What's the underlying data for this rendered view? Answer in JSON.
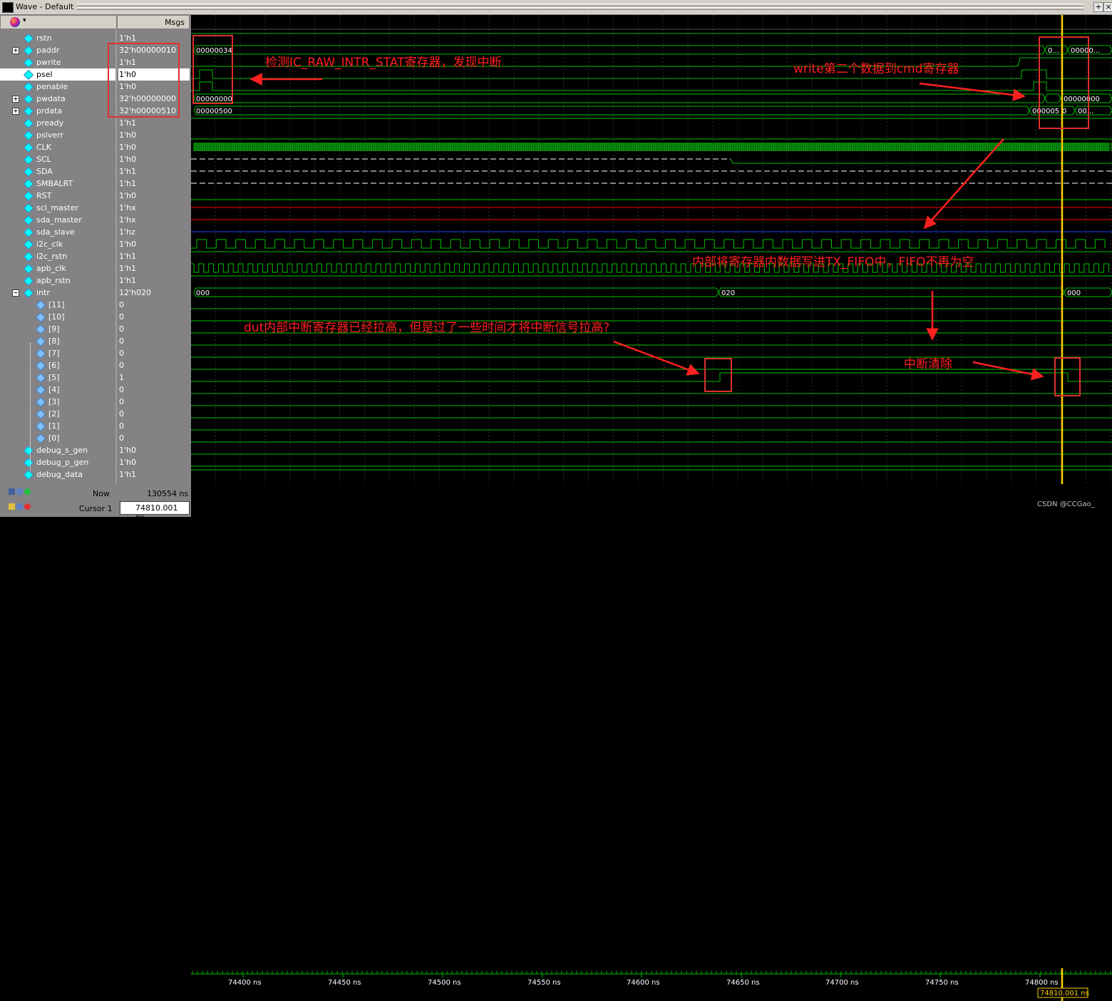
{
  "window": {
    "title": "Wave - Default",
    "buttons": [
      "+",
      "×"
    ]
  },
  "header": {
    "msgs_label": "Msgs"
  },
  "signals": [
    {
      "name": "rstn",
      "value": "1'h1",
      "expandable": false,
      "indent": 0
    },
    {
      "name": "paddr",
      "value": "32'h00000010",
      "expandable": true,
      "indent": 0
    },
    {
      "name": "pwrite",
      "value": "1'h1",
      "expandable": false,
      "indent": 0
    },
    {
      "name": "psel",
      "value": "1'h0",
      "expandable": false,
      "indent": 0,
      "selected": true
    },
    {
      "name": "penable",
      "value": "1'h0",
      "expandable": false,
      "indent": 0
    },
    {
      "name": "pwdata",
      "value": "32'h00000000",
      "expandable": true,
      "indent": 0
    },
    {
      "name": "prdata",
      "value": "32'h00000510",
      "expandable": true,
      "indent": 0
    },
    {
      "name": "pready",
      "value": "1'h1",
      "expandable": false,
      "indent": 0
    },
    {
      "name": "pslverr",
      "value": "1'h0",
      "expandable": false,
      "indent": 0
    },
    {
      "name": "CLK",
      "value": "1'h0",
      "expandable": false,
      "indent": 0
    },
    {
      "name": "SCL",
      "value": "1'h0",
      "expandable": false,
      "indent": 0
    },
    {
      "name": "SDA",
      "value": "1'h1",
      "expandable": false,
      "indent": 0
    },
    {
      "name": "SMBALRT",
      "value": "1'h1",
      "expandable": false,
      "indent": 0
    },
    {
      "name": "RST",
      "value": "1'h0",
      "expandable": false,
      "indent": 0
    },
    {
      "name": "scl_master",
      "value": "1'hx",
      "expandable": false,
      "indent": 0
    },
    {
      "name": "sda_master",
      "value": "1'hx",
      "expandable": false,
      "indent": 0
    },
    {
      "name": "sda_slave",
      "value": "1'hz",
      "expandable": false,
      "indent": 0
    },
    {
      "name": "i2c_clk",
      "value": "1'h0",
      "expandable": false,
      "indent": 0
    },
    {
      "name": "i2c_rstn",
      "value": "1'h1",
      "expandable": false,
      "indent": 0
    },
    {
      "name": "apb_clk",
      "value": "1'h1",
      "expandable": false,
      "indent": 0
    },
    {
      "name": "apb_rstn",
      "value": "1'h1",
      "expandable": false,
      "indent": 0
    },
    {
      "name": "intr",
      "value": "12'h020",
      "expandable": true,
      "expanded": true,
      "indent": 0
    },
    {
      "name": "[11]",
      "value": "0",
      "expandable": false,
      "indent": 1
    },
    {
      "name": "[10]",
      "value": "0",
      "expandable": false,
      "indent": 1
    },
    {
      "name": "[9]",
      "value": "0",
      "expandable": false,
      "indent": 1
    },
    {
      "name": "[8]",
      "value": "0",
      "expandable": false,
      "indent": 1
    },
    {
      "name": "[7]",
      "value": "0",
      "expandable": false,
      "indent": 1
    },
    {
      "name": "[6]",
      "value": "0",
      "expandable": false,
      "indent": 1
    },
    {
      "name": "[5]",
      "value": "1",
      "expandable": false,
      "indent": 1
    },
    {
      "name": "[4]",
      "value": "0",
      "expandable": false,
      "indent": 1
    },
    {
      "name": "[3]",
      "value": "0",
      "expandable": false,
      "indent": 1
    },
    {
      "name": "[2]",
      "value": "0",
      "expandable": false,
      "indent": 1
    },
    {
      "name": "[1]",
      "value": "0",
      "expandable": false,
      "indent": 1
    },
    {
      "name": "[0]",
      "value": "0",
      "expandable": false,
      "indent": 1
    },
    {
      "name": "debug_s_gen",
      "value": "1'h0",
      "expandable": false,
      "indent": 0
    },
    {
      "name": "debug_p_gen",
      "value": "1'h0",
      "expandable": false,
      "indent": 0
    },
    {
      "name": "debug_data",
      "value": "1'h1",
      "expandable": false,
      "indent": 0
    }
  ],
  "bus_labels": {
    "paddr_start": "00000034",
    "paddr_mid": "0...",
    "paddr_end": "00000...",
    "pwdata_start": "00000000",
    "pwdata_end": "00000000",
    "prdata_start": "00000500",
    "prdata_mid": "000005",
    "prdata_mid2": "0",
    "prdata_end": "00...",
    "intr_start": "000",
    "intr_mid": "020",
    "intr_end": "000"
  },
  "bottom": {
    "now_label": "Now",
    "now_value": "130554 ns",
    "cursor_label": "Cursor 1",
    "cursor_value": "74810.001 ns",
    "cursor_tag": "74810.001 ns"
  },
  "time_ticks": [
    "74400 ns",
    "74450 ns",
    "74500 ns",
    "74550 ns",
    "74600 ns",
    "74650 ns",
    "74700 ns",
    "74750 ns",
    "74800 ns"
  ],
  "annotations": {
    "a1": "检测IC_RAW_INTR_STAT寄存器，发现中断",
    "a2": "write第二个数据到cmd寄存器",
    "a3": "内部将寄存器内数据写进TX_FIFO中，FIFO不再为空",
    "a4": "dut内部中断寄存器已经拉高，但是过了一些时间才将中断信号拉高?",
    "a5": "中断清除"
  },
  "watermark": "CSDN @CCGao_",
  "colors": {
    "wave_green": "#00c000",
    "cursor_yellow": "#ffd000",
    "annotation_red": "#ff2020",
    "x_red": "#ff0000",
    "z_blue": "#2040ff"
  }
}
